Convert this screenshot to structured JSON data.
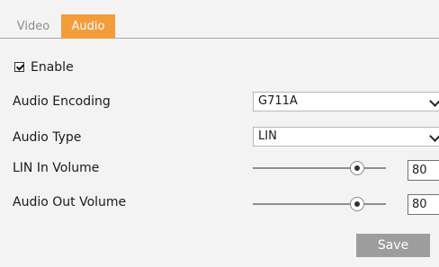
{
  "tabs": [
    {
      "label": "Video",
      "active": false
    },
    {
      "label": "Audio",
      "active": true
    }
  ],
  "enable": {
    "label": "Enable",
    "checked": true
  },
  "audio_encoding": {
    "label": "Audio Encoding",
    "value": "G711A"
  },
  "audio_type": {
    "label": "Audio Type",
    "value": "LIN"
  },
  "lin_in_volume": {
    "label": "LIN In Volume",
    "value": "80"
  },
  "audio_out_volume": {
    "label": "Audio Out Volume",
    "value": "80"
  },
  "save_label": "Save",
  "colors": {
    "accent": "#f39c3a",
    "button": "#9d9d9d",
    "background": "#f3f3f3"
  },
  "icons": {
    "dropdown": "chevron-down-icon",
    "checkbox": "checkmark-icon",
    "slider": "slider-thumb"
  }
}
